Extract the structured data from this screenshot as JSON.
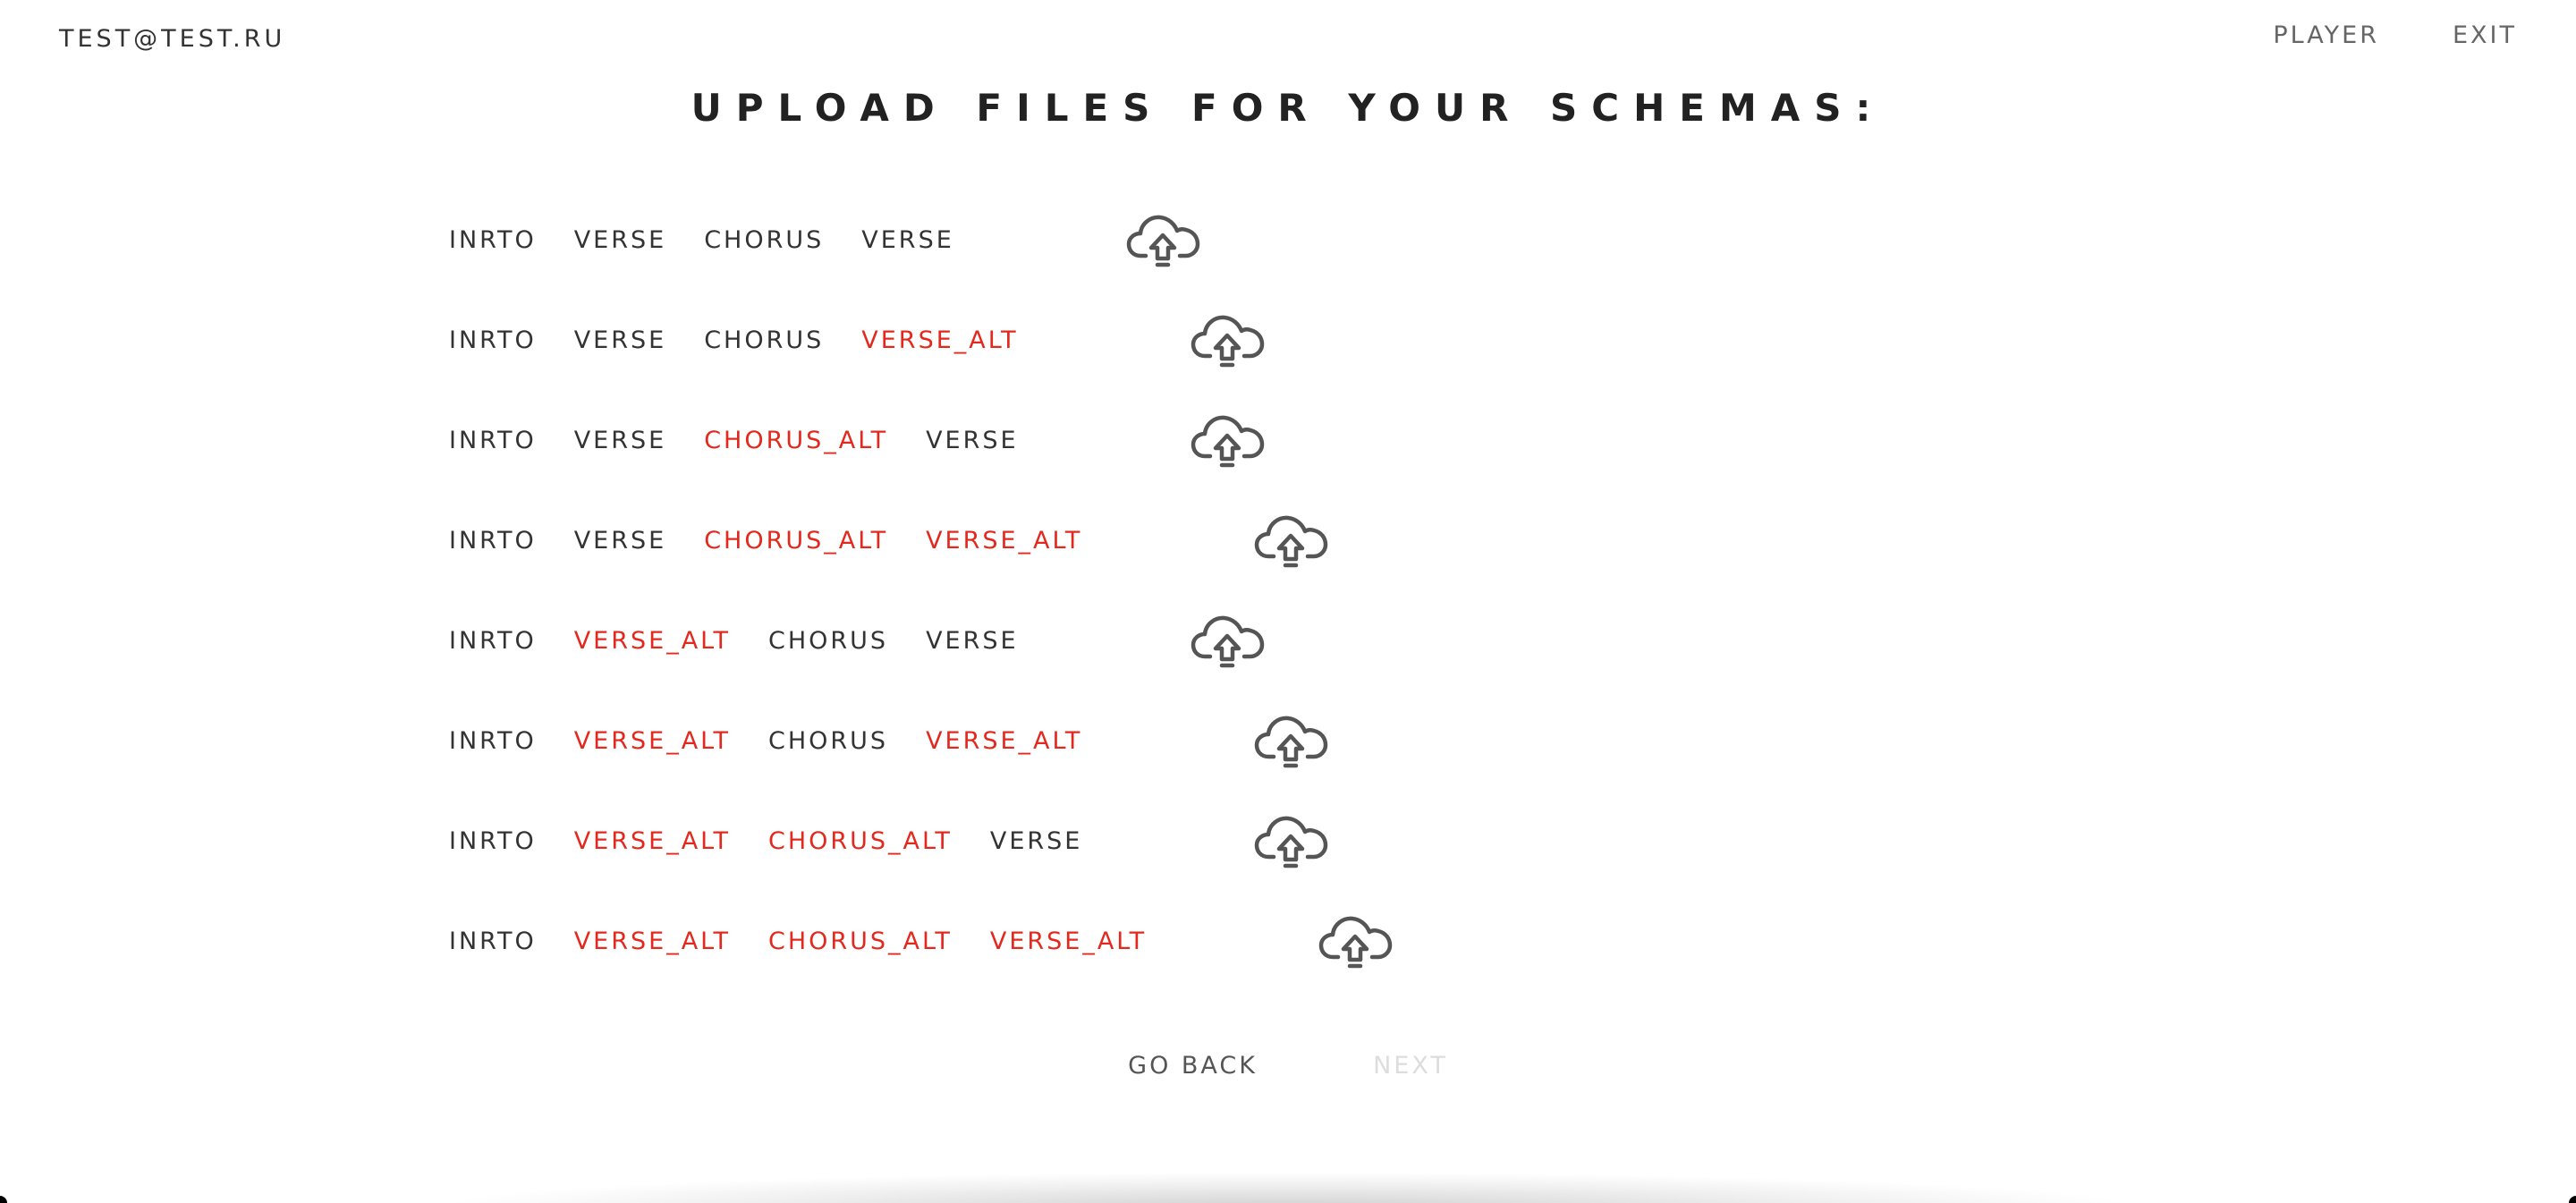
{
  "header": {
    "user_email": "TEST@TEST.RU",
    "nav": {
      "player_label": "PLAYER",
      "exit_label": "EXIT"
    }
  },
  "main": {
    "title": "UPLOAD FILES FOR YOUR SCHEMAS:",
    "icon": "cloud-upload-icon",
    "alt_color": "#e3281e",
    "schemas": [
      {
        "segments": [
          {
            "label": "INRTO",
            "alt": false
          },
          {
            "label": "VERSE",
            "alt": false
          },
          {
            "label": "CHORUS",
            "alt": false
          },
          {
            "label": "VERSE",
            "alt": false
          }
        ]
      },
      {
        "segments": [
          {
            "label": "INRTO",
            "alt": false
          },
          {
            "label": "VERSE",
            "alt": false
          },
          {
            "label": "CHORUS",
            "alt": false
          },
          {
            "label": "VERSE_ALT",
            "alt": true
          }
        ]
      },
      {
        "segments": [
          {
            "label": "INRTO",
            "alt": false
          },
          {
            "label": "VERSE",
            "alt": false
          },
          {
            "label": "CHORUS_ALT",
            "alt": true
          },
          {
            "label": "VERSE",
            "alt": false
          }
        ]
      },
      {
        "segments": [
          {
            "label": "INRTO",
            "alt": false
          },
          {
            "label": "VERSE",
            "alt": false
          },
          {
            "label": "CHORUS_ALT",
            "alt": true
          },
          {
            "label": "VERSE_ALT",
            "alt": true
          }
        ]
      },
      {
        "segments": [
          {
            "label": "INRTO",
            "alt": false
          },
          {
            "label": "VERSE_ALT",
            "alt": true
          },
          {
            "label": "CHORUS",
            "alt": false
          },
          {
            "label": "VERSE",
            "alt": false
          }
        ]
      },
      {
        "segments": [
          {
            "label": "INRTO",
            "alt": false
          },
          {
            "label": "VERSE_ALT",
            "alt": true
          },
          {
            "label": "CHORUS",
            "alt": false
          },
          {
            "label": "VERSE_ALT",
            "alt": true
          }
        ]
      },
      {
        "segments": [
          {
            "label": "INRTO",
            "alt": false
          },
          {
            "label": "VERSE_ALT",
            "alt": true
          },
          {
            "label": "CHORUS_ALT",
            "alt": true
          },
          {
            "label": "VERSE",
            "alt": false
          }
        ]
      },
      {
        "segments": [
          {
            "label": "INRTO",
            "alt": false
          },
          {
            "label": "VERSE_ALT",
            "alt": true
          },
          {
            "label": "CHORUS_ALT",
            "alt": true
          },
          {
            "label": "VERSE_ALT",
            "alt": true
          }
        ]
      }
    ]
  },
  "footer": {
    "back_label": "GO BACK",
    "next_label": "NEXT"
  }
}
